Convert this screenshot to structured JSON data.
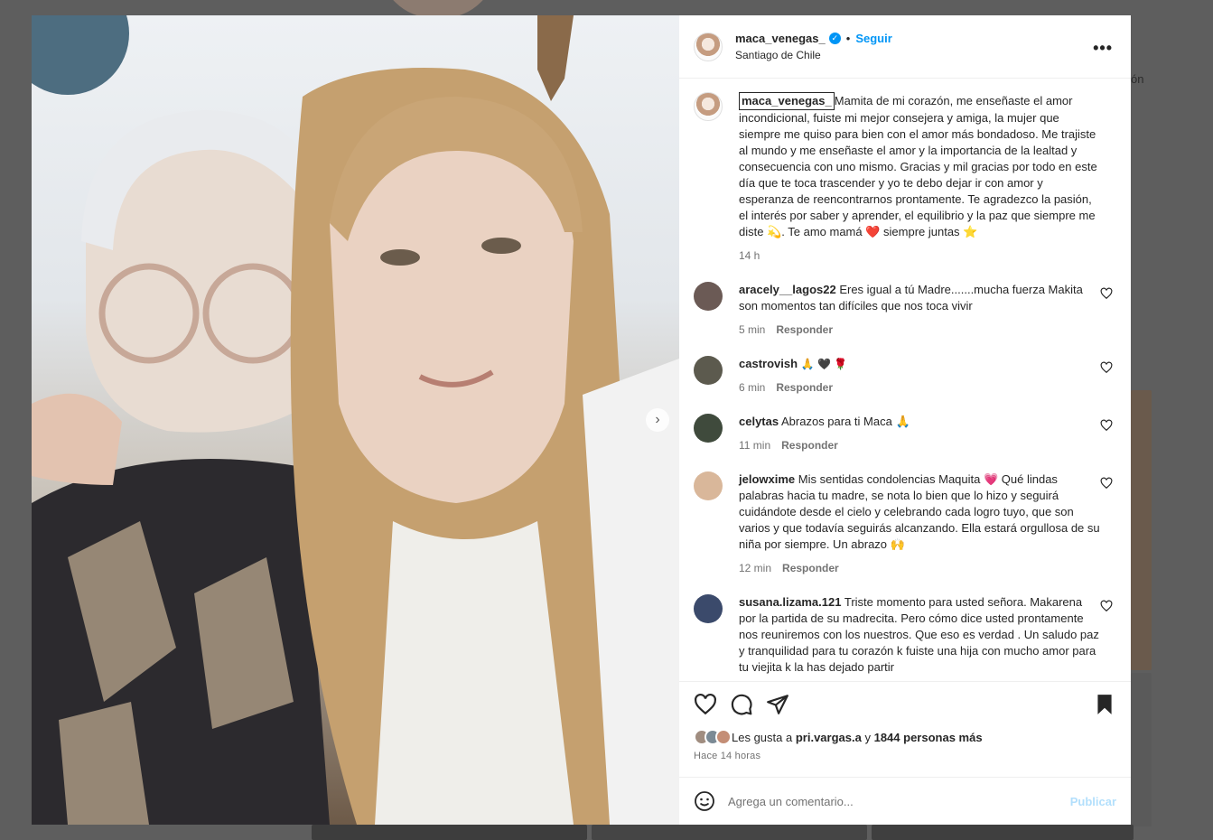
{
  "post": {
    "username": "maca_venegas_",
    "follow_label": "Seguir",
    "location": "Santiago de Chile",
    "more_label": "•••",
    "caption": {
      "text": "Mamita de mi corazón, me enseñaste el amor incondicional, fuiste mi mejor consejera y amiga, la mujer que siempre me quiso para bien con el amor más bondadoso. Me trajiste al mundo y me enseñaste el amor y la importancia de la lealtad y consecuencia con uno mismo. Gracias y mil gracias por todo en este día que te toca trascender y yo te debo dejar ir con amor y esperanza de reencontrarnos prontamente. Te agradezco la pasión, el interés por saber y aprender, el equilibrio y la paz que siempre me diste 💫. Te amo mamá ❤️ siempre juntas ⭐",
      "time": "14 h"
    },
    "reply_label": "Responder",
    "comments": [
      {
        "user": "aracely__lagos22",
        "text": "Eres igual a tú Madre.......mucha fuerza Makita son momentos tan difíciles que nos toca vivir",
        "time": "5 min",
        "avatar_color": "#6b5a55"
      },
      {
        "user": "castrovish",
        "text": "🙏 🖤 🌹",
        "time": "6 min",
        "avatar_color": "#5c5a4e"
      },
      {
        "user": "celytas",
        "text": "Abrazos para ti Maca 🙏",
        "time": "11 min",
        "avatar_color": "#3f4a3c"
      },
      {
        "user": "jelowxime",
        "text": "Mis sentidas condolencias Maquita 💗 Qué lindas palabras hacia tu madre, se nota lo bien que lo hizo y seguirá cuidándote desde el cielo y celebrando cada logro tuyo, que son varios y que todavía seguirás alcanzando. Ella estará orgullosa de su niña por siempre. Un abrazo 🙌",
        "time": "12 min",
        "avatar_color": "#d9b79a"
      },
      {
        "user": "susana.lizama.121",
        "text": "Triste momento para usted señora. Makarena por la partida de su madrecita. Pero cómo dice usted prontamente nos reuniremos con los nuestros. Que eso es verdad . Un saludo paz y tranquilidad para tu corazón k fuiste una hija con mucho amor para tu viejita k la has dejado partir",
        "time": "",
        "avatar_color": "#3b4a6b"
      }
    ],
    "likes": {
      "prefix": "Les gusta a",
      "user": "pri.vargas.a",
      "connector": "y",
      "others": "1844 personas más"
    },
    "time_ago": "Hace 14 horas",
    "add_comment_placeholder": "Agrega un comentario...",
    "publish_label": "Publicar"
  },
  "background": {
    "partial_text": "ón"
  },
  "icons": {
    "verified": "verified-badge-icon",
    "more": "more-options-icon",
    "like": "heart-icon",
    "comment": "comment-icon",
    "share": "paper-plane-icon",
    "save": "bookmark-icon",
    "emoji": "emoji-smiley-icon",
    "next": "chevron-right-icon"
  },
  "colors": {
    "link_blue": "#0095f6",
    "publish_disabled": "#b2dffc",
    "like_red": "#ed4956"
  }
}
